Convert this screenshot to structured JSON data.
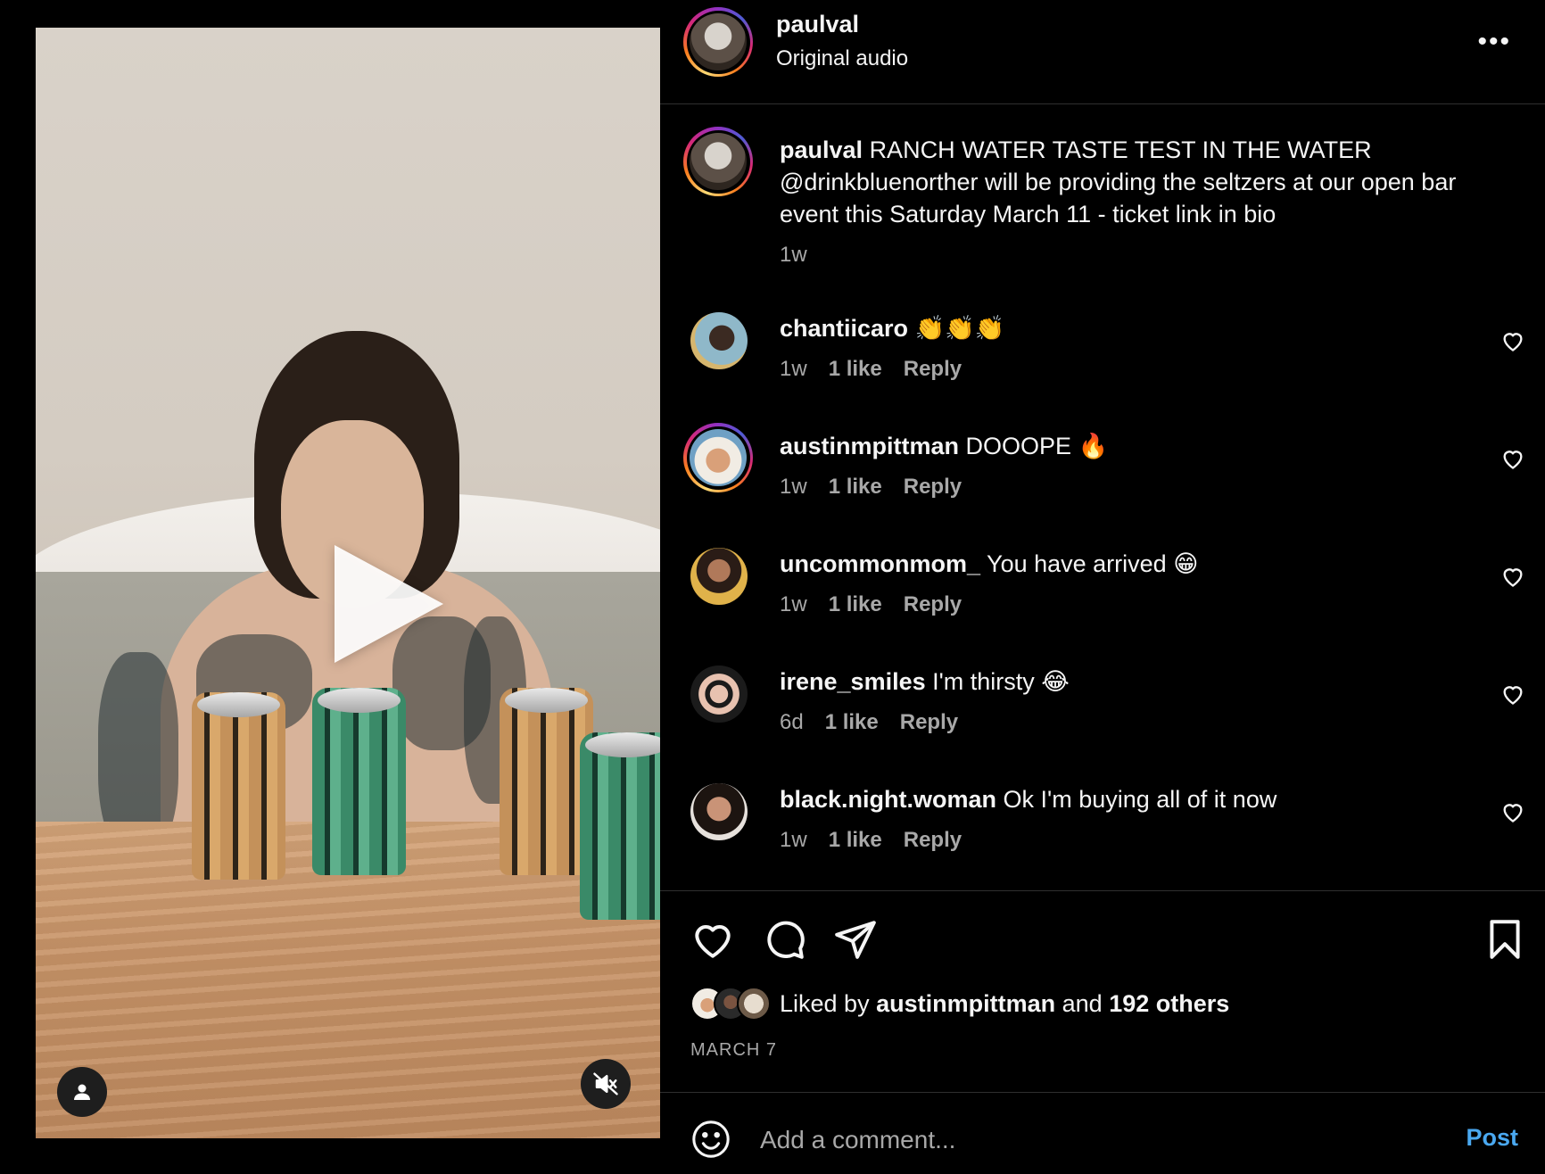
{
  "post": {
    "author": "paulval",
    "audio": "Original audio",
    "caption_user": "paulval",
    "caption_text": "RANCH WATER TASTE TEST IN THE WATER @drinkbluenorther will be providing the seltzers at our open bar event this Saturday March 11 - ticket link in bio",
    "caption_time": "1w"
  },
  "comments": [
    {
      "user": "chantiicaro",
      "text": "👏👏👏",
      "time": "1w",
      "likes": "1 like",
      "reply": "Reply"
    },
    {
      "user": "austinmpittman",
      "text": "DOOOPE 🔥",
      "time": "1w",
      "likes": "1 like",
      "reply": "Reply"
    },
    {
      "user": "uncommonmom_",
      "text": "You have arrived 😁",
      "time": "1w",
      "likes": "1 like",
      "reply": "Reply"
    },
    {
      "user": "irene_smiles",
      "text": "I'm thirsty 😂",
      "time": "6d",
      "likes": "1 like",
      "reply": "Reply"
    },
    {
      "user": "black.night.woman",
      "text": "Ok I'm buying all of it now",
      "time": "1w",
      "likes": "1 like",
      "reply": "Reply"
    }
  ],
  "likes": {
    "prefix": "Liked by",
    "user": "austinmpittman",
    "middle": "and",
    "others": "192 others"
  },
  "date": "MARCH 7",
  "add_comment": {
    "placeholder": "Add a comment...",
    "post_label": "Post"
  },
  "colors": {
    "background": "#000000",
    "secondary_text": "#a8a8a8",
    "post_button": "#4aa8f0",
    "divider": "#2f2f2f"
  },
  "icons": [
    "more-icon",
    "heart-icon",
    "comment-icon",
    "share-icon",
    "bookmark-icon",
    "emoji-icon",
    "play-icon",
    "user-tag-icon",
    "mute-icon"
  ]
}
